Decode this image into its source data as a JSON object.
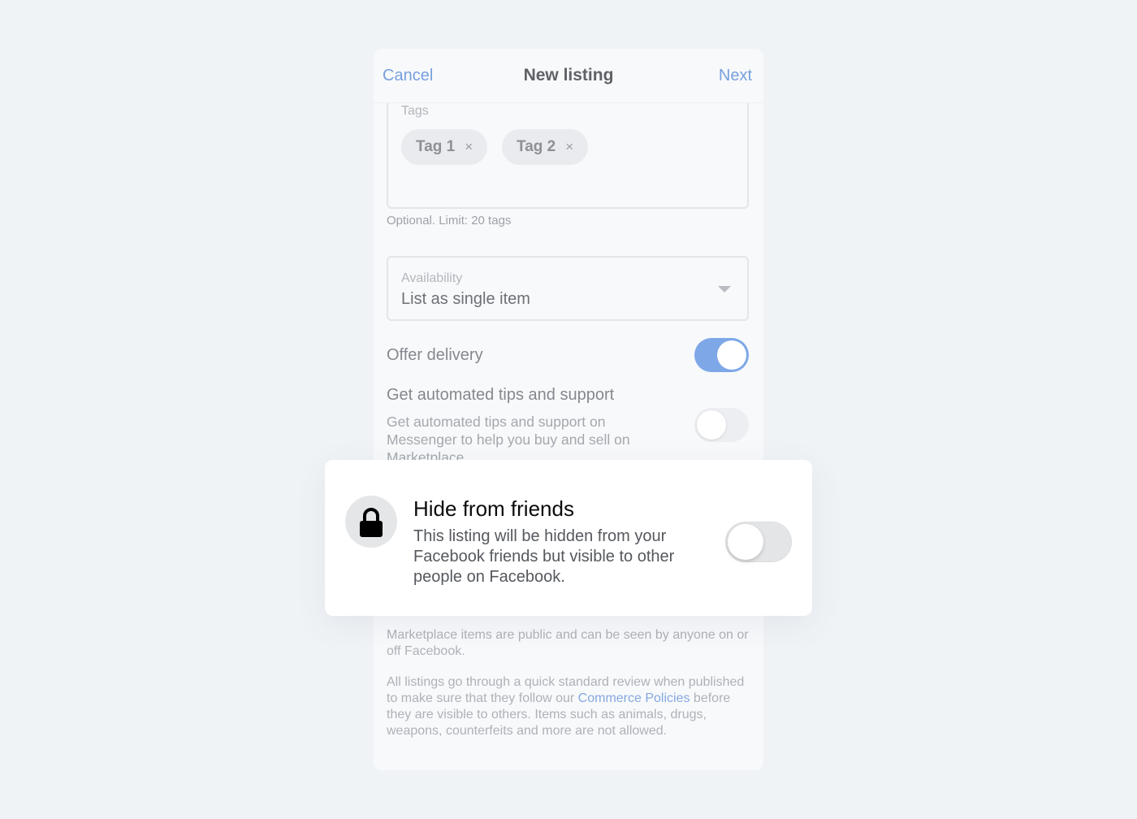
{
  "header": {
    "cancel": "Cancel",
    "title": "New listing",
    "next": "Next"
  },
  "tags": {
    "label": "Tags",
    "chips": [
      "Tag 1",
      "Tag 2"
    ],
    "remove_glyph": "×",
    "helper": "Optional. Limit: 20 tags"
  },
  "availability": {
    "label": "Availability",
    "value": "List as single item"
  },
  "offer_delivery": {
    "label": "Offer delivery",
    "enabled": true
  },
  "tips": {
    "label": "Get automated tips and support",
    "description": "Get automated tips and support on Messenger to help you buy and sell on Marketplace.",
    "enabled": false
  },
  "hide_from_friends": {
    "title": "Hide from friends",
    "description": "This listing will be hidden from your Facebook friends but visible to other people on Facebook.",
    "enabled": false,
    "icon": "lock-icon"
  },
  "footer": {
    "public_note": "Marketplace items are public and can be seen by anyone on or off Facebook.",
    "review_before": "All listings go through a quick standard review when published to make sure that they follow our ",
    "review_link": "Commerce Policies",
    "review_after": " before they are visible to others. Items such as animals, drugs, weapons, counterfeits and more are not allowed."
  },
  "colors": {
    "accent": "#78a0dc",
    "toggle_on": "#7ea7e8",
    "background": "#f0f3f6"
  }
}
